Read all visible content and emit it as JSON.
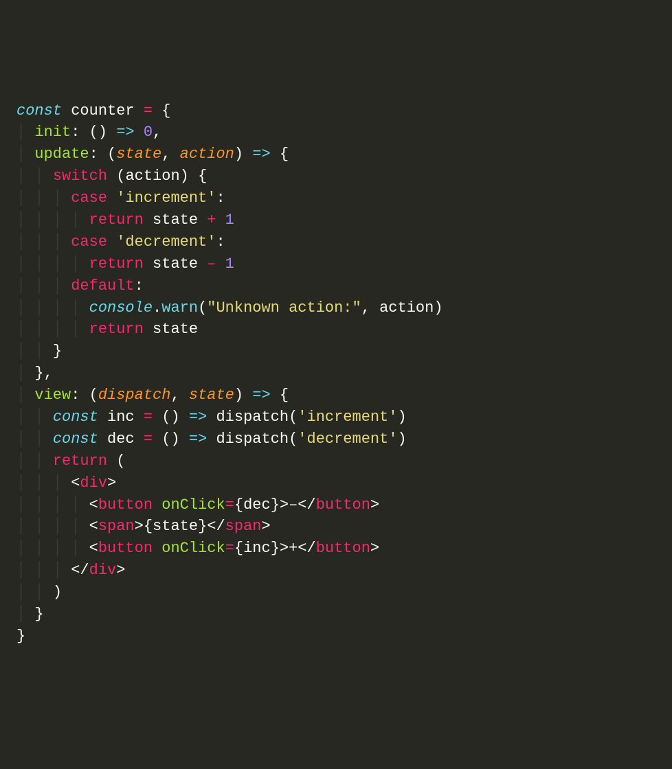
{
  "code": {
    "l1": {
      "const": "const",
      "counter": "counter",
      "eq": "=",
      "brace": "{"
    },
    "l2": {
      "init": "init",
      "colon": ":",
      "lp": "(",
      "rp": ")",
      "arrow": "=>",
      "zero": "0",
      "comma": ","
    },
    "l3": {
      "update": "update",
      "colon": ":",
      "lp": "(",
      "state": "state",
      "comma1": ",",
      "action": "action",
      "rp": ")",
      "arrow": "=>",
      "brace": "{"
    },
    "l4": {
      "switch": "switch",
      "lp": "(",
      "action": "action",
      "rp": ")",
      "brace": "{"
    },
    "l5": {
      "case": "case",
      "str": "'increment'",
      "colon": ":"
    },
    "l6": {
      "return": "return",
      "state": "state",
      "plus": "+",
      "one": "1"
    },
    "l7": {
      "case": "case",
      "str": "'decrement'",
      "colon": ":"
    },
    "l8": {
      "return": "return",
      "state": "state",
      "minus": "–",
      "one": "1"
    },
    "l9": {
      "default": "default",
      "colon": ":"
    },
    "l10": {
      "console": "console",
      "dot": ".",
      "warn": "warn",
      "lp": "(",
      "str": "\"Unknown action:\"",
      "comma": ",",
      "action": "action",
      "rp": ")"
    },
    "l11": {
      "return": "return",
      "state": "state"
    },
    "l12": {
      "brace": "}"
    },
    "l13": {
      "brace": "}",
      "comma": ","
    },
    "l14": {
      "view": "view",
      "colon": ":",
      "lp": "(",
      "dispatch": "dispatch",
      "comma": ",",
      "state": "state",
      "rp": ")",
      "arrow": "=>",
      "brace": "{"
    },
    "l15": {
      "const": "const",
      "inc": "inc",
      "eq": "=",
      "lp": "(",
      "rp": ")",
      "arrow": "=>",
      "dispatch": "dispatch",
      "lp2": "(",
      "str": "'increment'",
      "rp2": ")"
    },
    "l16": {
      "const": "const",
      "dec": "dec",
      "eq": "=",
      "lp": "(",
      "rp": ")",
      "arrow": "=>",
      "dispatch": "dispatch",
      "lp2": "(",
      "str": "'decrement'",
      "rp2": ")"
    },
    "l17": {
      "return": "return",
      "lp": "("
    },
    "l18": {
      "lt": "<",
      "div": "div",
      "gt": ">"
    },
    "l19": {
      "lt": "<",
      "button": "button",
      "onClick": "onClick",
      "eq": "=",
      "lb": "{",
      "dec": "dec",
      "rb": "}",
      "gt": ">",
      "txt": "–",
      "lt2": "<",
      "slash": "/",
      "button2": "button",
      "gt2": ">"
    },
    "l20": {
      "lt": "<",
      "span": "span",
      "gt": ">",
      "lb": "{",
      "state": "state",
      "rb": "}",
      "lt2": "<",
      "slash": "/",
      "span2": "span",
      "gt2": ">"
    },
    "l21": {
      "lt": "<",
      "button": "button",
      "onClick": "onClick",
      "eq": "=",
      "lb": "{",
      "inc": "inc",
      "rb": "}",
      "gt": ">",
      "txt": "+",
      "lt2": "<",
      "slash": "/",
      "button2": "button",
      "gt2": ">"
    },
    "l22": {
      "lt": "<",
      "slash": "/",
      "div": "div",
      "gt": ">"
    },
    "l23": {
      "rp": ")"
    },
    "l24": {
      "brace": "}"
    },
    "l25": {
      "brace": "}"
    },
    "guide": "│"
  }
}
